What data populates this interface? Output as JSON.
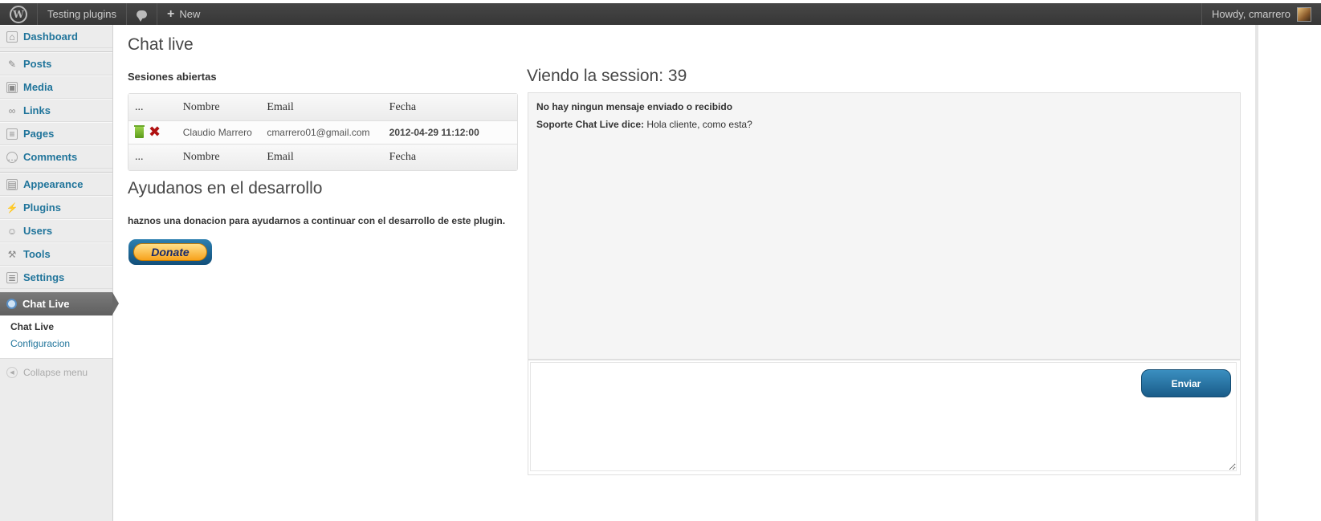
{
  "adminbar": {
    "site_name": "Testing plugins",
    "new_label": "New",
    "howdy": "Howdy, cmarrero",
    "icons": [
      "wordpress-logo-icon",
      "comment-bubble-icon",
      "plus-icon",
      "avatar"
    ]
  },
  "sidebar": {
    "items": [
      {
        "label": "Dashboard",
        "icon": "dashboard-icon"
      },
      {
        "label": "Posts",
        "icon": "pushpin-icon"
      },
      {
        "label": "Media",
        "icon": "media-icon"
      },
      {
        "label": "Links",
        "icon": "link-icon"
      },
      {
        "label": "Pages",
        "icon": "pages-icon"
      },
      {
        "label": "Comments",
        "icon": "comments-icon"
      },
      {
        "label": "Appearance",
        "icon": "appearance-icon"
      },
      {
        "label": "Plugins",
        "icon": "plugin-icon"
      },
      {
        "label": "Users",
        "icon": "users-icon"
      },
      {
        "label": "Tools",
        "icon": "tools-icon"
      },
      {
        "label": "Settings",
        "icon": "settings-icon"
      }
    ],
    "active": {
      "label": "Chat Live",
      "icon": "gear-icon"
    },
    "submenu": [
      {
        "label": "Chat Live",
        "current": true
      },
      {
        "label": "Configuracion",
        "current": false
      }
    ],
    "collapse_label": "Collapse menu"
  },
  "main": {
    "title": "Chat live",
    "sessions_heading": "Sesiones abiertas",
    "table": {
      "headers": [
        "...",
        "Nombre",
        "Email",
        "Fecha"
      ],
      "rows": [
        {
          "name": "Claudio Marrero",
          "email": "cmarrero01@gmail.com",
          "date": "2012-04-29",
          "time": "11:12:00"
        }
      ]
    },
    "help_title": "Ayudanos en el desarrollo",
    "help_text": "haznos una donacion para ayudarnos a continuar con el desarrollo de este plugin.",
    "donate_label": "Donate"
  },
  "chat": {
    "session_title": "Viendo la session: 39",
    "empty_notice": "No hay ningun mensaje enviado o recibido",
    "messages": [
      {
        "sender": "Soporte Chat Live dice:",
        "text": "Hola cliente, como esta?"
      }
    ],
    "reply_value": "",
    "send_label": "Enviar"
  },
  "colors": {
    "adminbar_bg": "#464646",
    "link": "#21759b",
    "active_menu": "#6d6d6d",
    "button_blue": "#21759b",
    "delete_red": "#b01010"
  }
}
